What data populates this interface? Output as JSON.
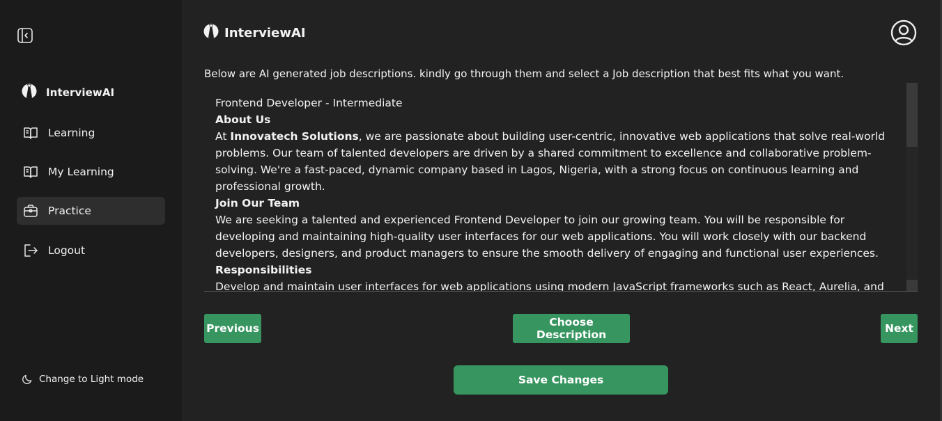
{
  "sidebar": {
    "brand": "InterviewAI",
    "items": [
      {
        "label": "Learning",
        "icon": "book-open-icon"
      },
      {
        "label": "My Learning",
        "icon": "book-open-icon"
      },
      {
        "label": "Practice",
        "icon": "briefcase-icon"
      },
      {
        "label": "Logout",
        "icon": "logout-icon"
      }
    ],
    "theme_toggle": "Change to Light mode"
  },
  "header": {
    "brand": "InterviewAI"
  },
  "main": {
    "intro": "Below are AI generated job descriptions. kindly go through them and select a Job description that best fits what you want.",
    "description": {
      "title": "Frontend Developer - Intermediate",
      "about_heading": "About Us",
      "about_prefix": "At ",
      "company": "Innovatech Solutions",
      "about_text": ", we are passionate about building user-centric, innovative web applications that solve real-world problems. Our team of talented developers are driven by a shared commitment to excellence and collaborative problem-solving. We're a fast-paced, dynamic company based in Lagos, Nigeria, with a strong focus on continuous learning and professional growth.",
      "join_heading": "Join Our Team",
      "join_text": "We are seeking a talented and experienced Frontend Developer to join our growing team. You will be responsible for developing and maintaining high-quality user interfaces for our web applications. You will work closely with our backend developers, designers, and product managers to ensure the smooth delivery of engaging and functional user experiences.",
      "resp_heading": "Responsibilities",
      "resp_text": "Develop and maintain user interfaces for web applications using modern JavaScript frameworks such as React, Aurelia, and"
    },
    "buttons": {
      "previous": "Previous",
      "choose": "Choose Description",
      "next": "Next",
      "save": "Save Changes"
    }
  },
  "colors": {
    "accent": "#379560",
    "sidebar_bg": "#1b1b1b",
    "main_bg": "#222222"
  }
}
